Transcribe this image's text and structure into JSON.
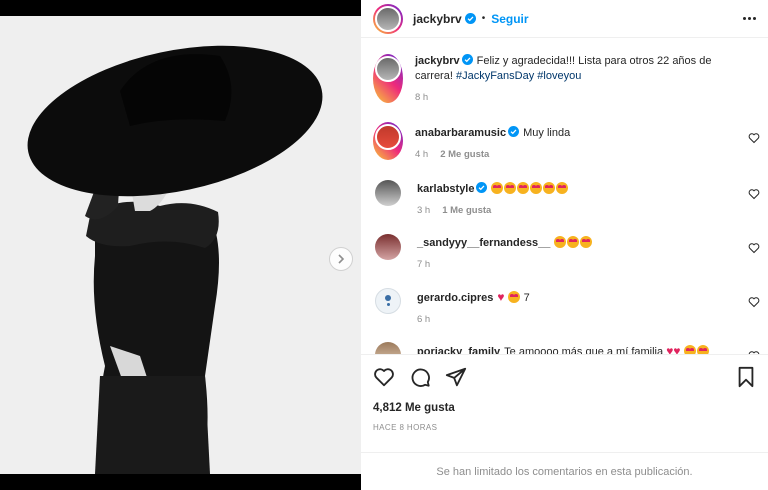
{
  "post": {
    "username": "jackybrv",
    "follow_label": "Seguir",
    "caption_user": "jackybrv",
    "caption_text": "Feliz y agradecida!!! Lista para otros 22 años de carrera! ",
    "hashtag1": "#JackyFansDay",
    "hashtag2": "#loveyou",
    "caption_time": "8 h",
    "likes": "4,812 Me gusta",
    "time_ago": "HACE 8 HORAS",
    "limited_notice": "Se han limitado los comentarios en esta publicación."
  },
  "comments": [
    {
      "user": "anabarbaramusic",
      "text": "Muy linda",
      "time": "4 h",
      "likes": "2 Me gusta"
    },
    {
      "user": "karlabstyle",
      "text": "",
      "time": "3 h",
      "likes": "1 Me gusta"
    },
    {
      "user": "_sandyyy__fernandess__",
      "text": "",
      "time": "7 h",
      "likes": ""
    },
    {
      "user": "gerardo.cipres",
      "text": "7",
      "time": "6 h",
      "likes": ""
    },
    {
      "user": "porjacky_family",
      "text": "Te amoooo más que a mí familia",
      "time": "",
      "likes": ""
    }
  ],
  "colors": {
    "accent": "#0095f6",
    "verified": "#0095f6",
    "hashtag": "#00376b",
    "muted": "#8e8e8e"
  },
  "icons": [
    "verified-badge-icon",
    "more-options-icon",
    "heart-icon",
    "comment-icon",
    "share-icon",
    "bookmark-icon",
    "chevron-right-icon"
  ]
}
